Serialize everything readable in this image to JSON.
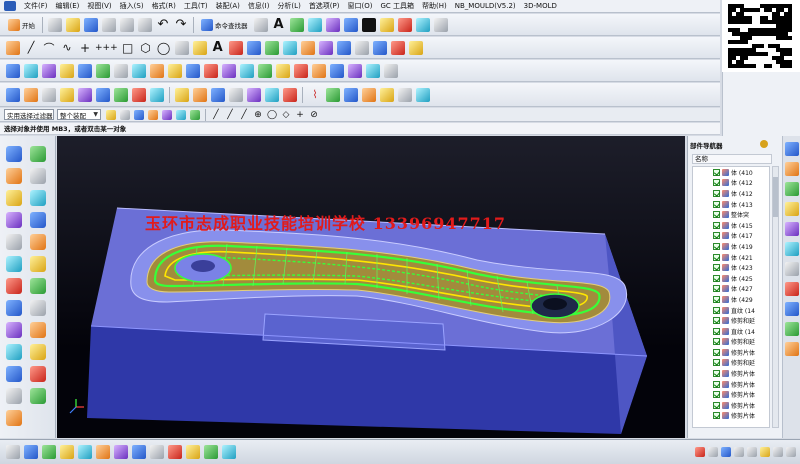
{
  "menu": {
    "items": [
      "文件(F)",
      "编辑(E)",
      "视图(V)",
      "插入(S)",
      "格式(R)",
      "工具(T)",
      "装配(A)",
      "信息(I)",
      "分析(L)",
      "首选项(P)",
      "窗口(O)",
      "GC 工具箱",
      "帮助(H)",
      "NB_MOULD(V5.2)",
      "3D-MOLD"
    ]
  },
  "toolbar_standard": {
    "start_label": "开始",
    "command_finder_label": "命令查找器"
  },
  "selection_bar": {
    "filter_value": "实用选择过滤器",
    "scope_value": "整个装配"
  },
  "cue_line": {
    "text": "选择对象并使用 MB3，或者双击某一对象"
  },
  "viewport": {
    "watermark": "玉环市志成职业技能培训学校 13396947717"
  },
  "part_navigator": {
    "title": "部件导航器",
    "column_header": "名称",
    "items": [
      "体 (410",
      "体 (412",
      "体 (412",
      "体 (413",
      "整体突",
      "体 (415",
      "体 (417",
      "体 (419",
      "体 (421",
      "体 (423",
      "体 (425",
      "体 (427",
      "体 (429",
      "直纹 (14",
      "修剪和延",
      "直纹 (14",
      "修剪和延",
      "修剪片体",
      "修剪和延",
      "修剪片体",
      "修剪片体",
      "修剪片体",
      "修剪片体",
      "修剪片体"
    ]
  },
  "colors": {
    "die_top": "#6b6fd6",
    "die_side": "#4e56c4",
    "die_front": "#2f38a8",
    "toolpath_green": "#38ff38",
    "toolpath_yellow": "#ffe600",
    "watermark": "#e21b1b"
  }
}
